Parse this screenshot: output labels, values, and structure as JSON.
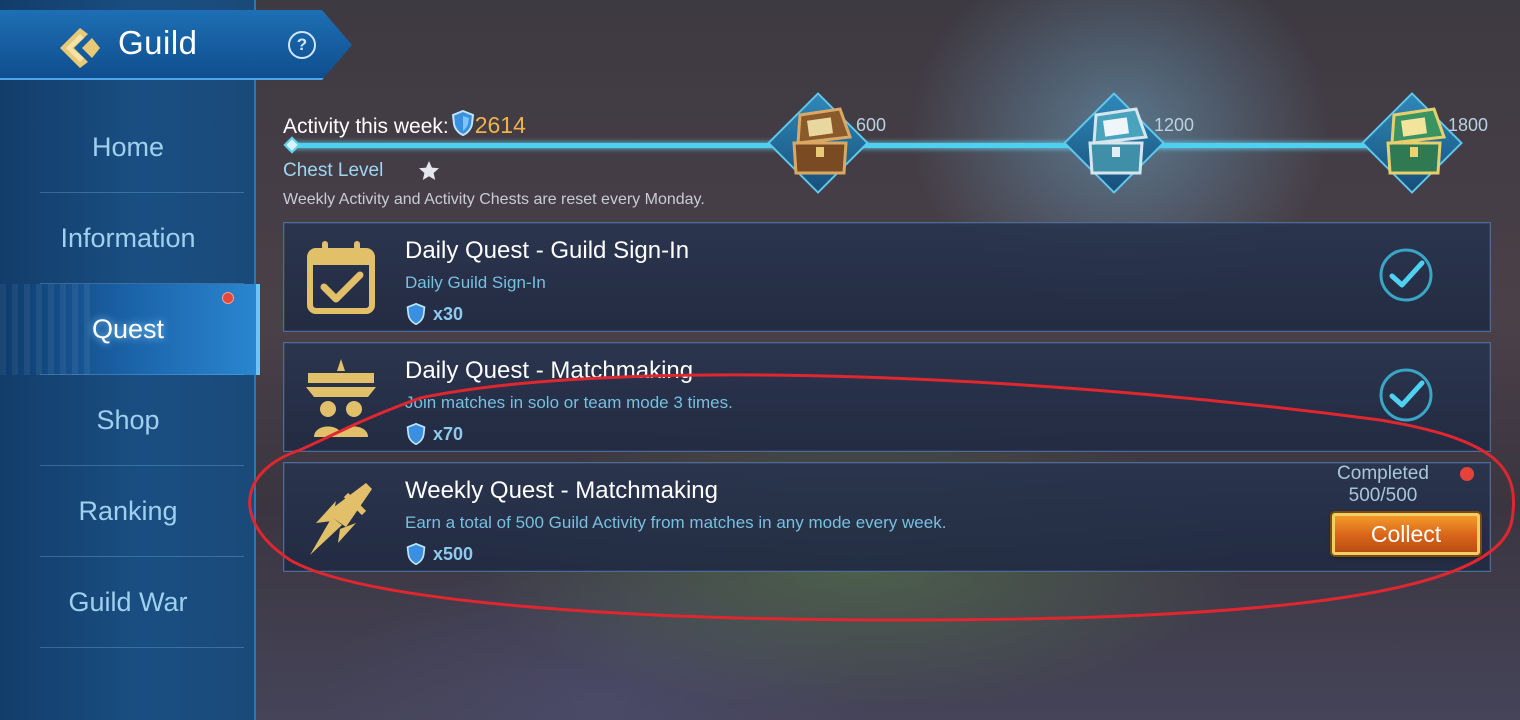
{
  "header": {
    "title": "Guild",
    "help_label": "?"
  },
  "sidebar": {
    "items": [
      {
        "label": "Home"
      },
      {
        "label": "Information"
      },
      {
        "label": "Quest",
        "active": true,
        "has_badge": true
      },
      {
        "label": "Shop"
      },
      {
        "label": "Ranking"
      },
      {
        "label": "Guild War"
      }
    ]
  },
  "activity": {
    "label": "Activity this week:",
    "value": "2614",
    "progress_fraction": 1.0,
    "milestones": [
      {
        "value": "600",
        "chest": "bronze-chest-icon"
      },
      {
        "value": "1200",
        "chest": "silver-chest-icon"
      },
      {
        "value": "1800",
        "chest": "gold-chest-icon"
      }
    ],
    "chest_level_label": "Chest Level",
    "reset_note": "Weekly Activity and Activity Chests are reset every Monday."
  },
  "quests": [
    {
      "title": "Daily Quest - Guild Sign-In",
      "description": "Daily Guild Sign-In",
      "reward": "x30",
      "icon": "calendar-check-icon",
      "status": "done"
    },
    {
      "title": "Daily Quest - Matchmaking",
      "description": "Join matches in solo or team mode 3 times.",
      "reward": "x70",
      "icon": "team-podium-icon",
      "status": "done"
    },
    {
      "title": "Weekly Quest - Matchmaking",
      "description": "Earn a total of 500 Guild Activity from matches in any mode every week.",
      "reward": "x500",
      "icon": "rocket-sword-icon",
      "status": "collect",
      "completed_label": "Completed",
      "progress": "500/500",
      "collect_label": "Collect"
    }
  ],
  "colors": {
    "accent_orange": "#f0b34a",
    "sidebar_blue": "#1a4e82",
    "annotation_red": "#e0262e",
    "check_cyan": "#4fd2f2"
  }
}
